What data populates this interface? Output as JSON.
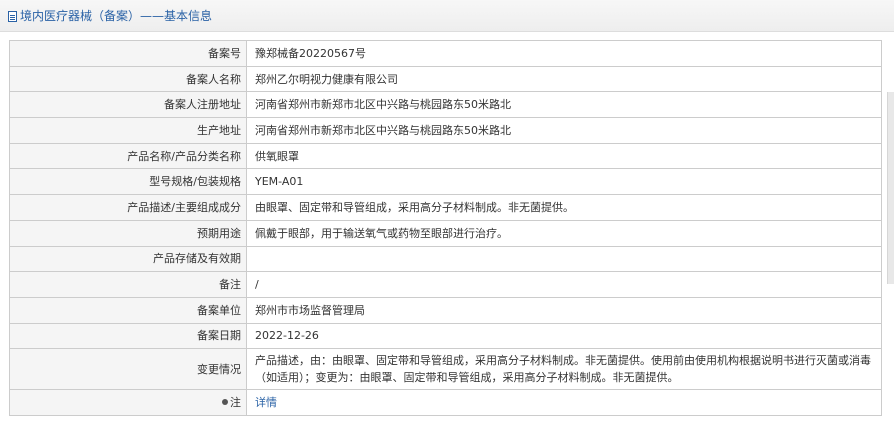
{
  "header": {
    "breadcrumb": "境内医疗器械（备案）——基本信息",
    "icon": "document-icon"
  },
  "rows": [
    {
      "label": "备案号",
      "value": "豫郑械备20220567号"
    },
    {
      "label": "备案人名称",
      "value": "郑州乙尔明视力健康有限公司"
    },
    {
      "label": "备案人注册地址",
      "value": "河南省郑州市新郑市北区中兴路与桃园路东50米路北"
    },
    {
      "label": "生产地址",
      "value": "河南省郑州市新郑市北区中兴路与桃园路东50米路北"
    },
    {
      "label": "产品名称/产品分类名称",
      "value": "供氧眼罩"
    },
    {
      "label": "型号规格/包装规格",
      "value": "YEM-A01"
    },
    {
      "label": "产品描述/主要组成成分",
      "value": "由眼罩、固定带和导管组成，采用高分子材料制成。非无菌提供。"
    },
    {
      "label": "预期用途",
      "value": "佩戴于眼部，用于输送氧气或药物至眼部进行治疗。"
    },
    {
      "label": "产品存储及有效期",
      "value": ""
    },
    {
      "label": "备注",
      "value": "/"
    },
    {
      "label": "备案单位",
      "value": "郑州市市场监督管理局"
    },
    {
      "label": "备案日期",
      "value": "2022-12-26"
    },
    {
      "label": "变更情况",
      "value": "产品描述，由：由眼罩、固定带和导管组成，采用高分子材料制成。非无菌提供。使用前由使用机构根据说明书进行灭菌或消毒（如适用）；变更为：由眼罩、固定带和导管组成，采用高分子材料制成。非无菌提供。"
    }
  ],
  "note": {
    "label": "注",
    "icon": "pin-icon",
    "link_text": "详情"
  },
  "colors": {
    "link": "#2a62a6",
    "label_bg": "#f5f5f5",
    "border": "#cccccc"
  }
}
